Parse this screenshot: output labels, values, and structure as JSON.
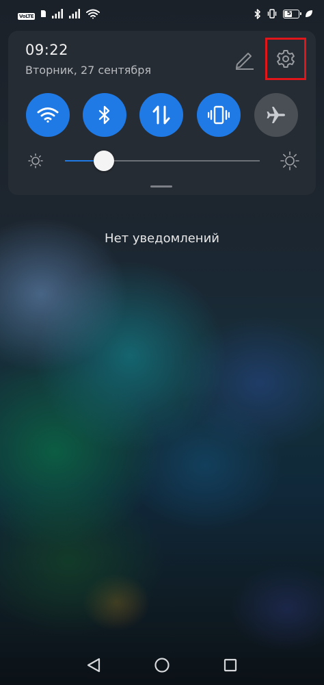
{
  "status_bar": {
    "volte_label": "VoLTE",
    "battery_level": "59",
    "battery_fraction": 0.59,
    "icons": [
      "volte-icon",
      "sim-icon",
      "signal-icon",
      "signal-icon",
      "wifi-icon",
      "bluetooth-icon",
      "vibrate-icon",
      "battery-icon",
      "leaf-icon"
    ]
  },
  "panel": {
    "time": "09:22",
    "date": "Вторник, 27 сентября",
    "edit_icon": "pencil-icon",
    "settings_icon": "gear-icon",
    "highlight_color": "#e0161b",
    "toggles": [
      {
        "icon": "wifi-icon",
        "state": "on"
      },
      {
        "icon": "bluetooth-icon",
        "state": "on"
      },
      {
        "icon": "mobile-data-icon",
        "state": "on"
      },
      {
        "icon": "vibrate-icon",
        "state": "on"
      },
      {
        "icon": "airplane-icon",
        "state": "off"
      }
    ],
    "brightness": {
      "level": 0.2,
      "low_icon": "sun-low-icon",
      "high_icon": "sun-high-icon"
    }
  },
  "notifications": {
    "empty_text": "Нет уведомлений"
  },
  "nav_bar": {
    "icons": [
      "back-icon",
      "home-icon",
      "recents-icon"
    ]
  },
  "colors": {
    "accent": "#1f7ae6",
    "toggle_off": "#4a4f56",
    "panel_bg": "#282d34"
  }
}
